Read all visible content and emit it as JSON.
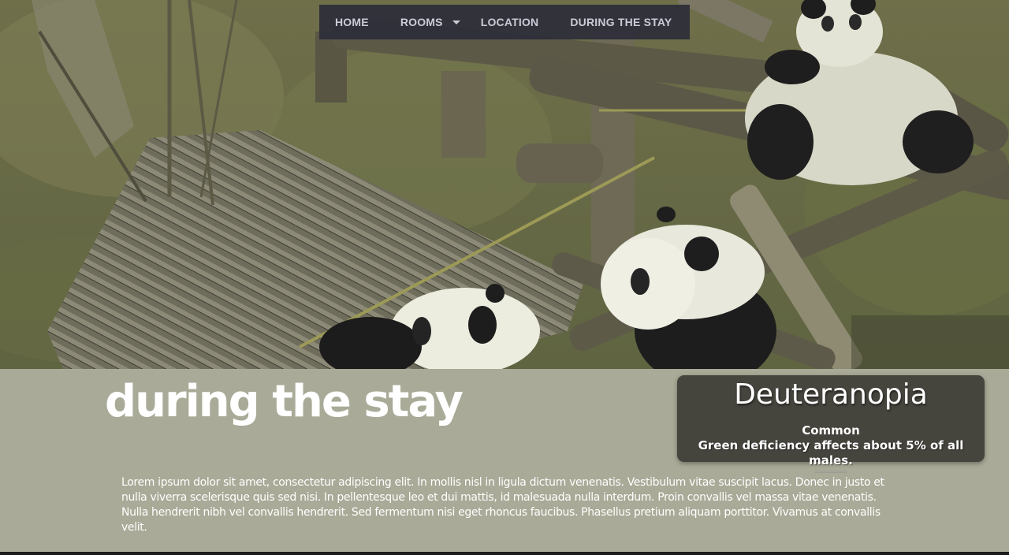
{
  "nav": {
    "items": [
      {
        "label": "HOME"
      },
      {
        "label": "ROOMS"
      },
      {
        "label": "LOCATION"
      },
      {
        "label": "DURING THE STAY"
      }
    ]
  },
  "page": {
    "title": "during the stay",
    "body": "Lorem ipsum dolor sit amet, consectetur adipiscing elit. In mollis nisl in ligula dictum venenatis. Vestibulum vitae suscipit lacus. Donec in justo et nulla viverra scelerisque quis sed nisi. In pellentesque leo et dui mattis, id malesuada nulla interdum. Proin convallis vel massa vitae venenatis. Nulla hendrerit nibh vel convallis hendrerit. Sed fermentum nisi eget rhoncus faucibus. Phasellus pretium aliquam porttitor. Vivamus at convallis velit."
  },
  "tooltip": {
    "title": "Deuteranopia",
    "subtitle": "Common",
    "description": "Green deficiency affects about 5% of all males."
  },
  "colors": {
    "band": "#a9aa97",
    "nav": "#2c2d3a",
    "card": "#45443d"
  }
}
